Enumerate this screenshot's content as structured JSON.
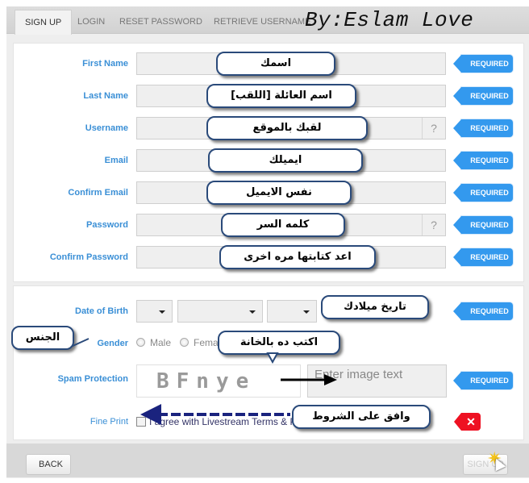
{
  "tabs": [
    {
      "label": "SIGN UP",
      "active": true
    },
    {
      "label": "LOGIN",
      "active": false
    },
    {
      "label": "RESET PASSWORD",
      "active": false
    },
    {
      "label": "RETRIEVE USERNAME",
      "active": false
    }
  ],
  "watermark": "By:Eslam Love",
  "required_label": "REQUIRED",
  "error_icon": "✕",
  "help_icon": "?",
  "account_fields": [
    {
      "label": "First Name",
      "callout": "اسمك",
      "has_help": false
    },
    {
      "label": "Last Name",
      "callout": "اسم العائلة [اللقب]",
      "has_help": false
    },
    {
      "label": "Username",
      "callout": "لقبك بالموقع",
      "has_help": true
    },
    {
      "label": "Email",
      "callout": "ايميلك",
      "has_help": false
    },
    {
      "label": "Confirm Email",
      "callout": "نفس الايميل",
      "has_help": false
    },
    {
      "label": "Password",
      "callout": "كلمه السر",
      "has_help": true
    },
    {
      "label": "Confirm Password",
      "callout": "اعد كتابتها مره اخرى",
      "has_help": false
    }
  ],
  "dob": {
    "label": "Date of Birth",
    "callout": "تاريخ ميلادك",
    "day": "",
    "month": "",
    "year": ""
  },
  "gender": {
    "label": "Gender",
    "callout": "الجنس",
    "options": [
      "Male",
      "Female"
    ]
  },
  "spam": {
    "label": "Spam Protection",
    "captcha_text": "BFnye",
    "placeholder": "Enter image text",
    "callout": "اكتب ده بالخانة"
  },
  "fine_print": {
    "label": "Fine Print",
    "text": "I agree with Livestream Terms & P",
    "callout": "وافق على الشروط",
    "checked": false
  },
  "footer": {
    "back": "BACK",
    "sign_up": "SIGN UP"
  }
}
